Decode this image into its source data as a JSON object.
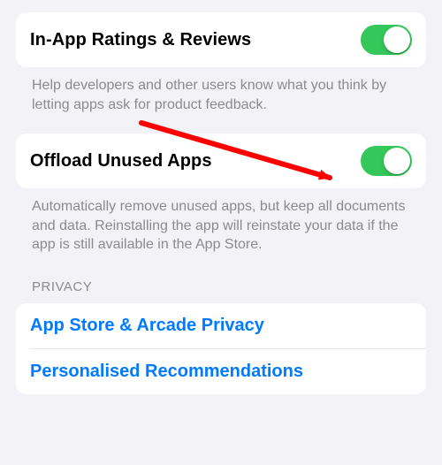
{
  "ratings": {
    "title": "In-App Ratings & Reviews",
    "toggle_on": true,
    "footer": "Help developers and other users know what you think by letting apps ask for product feedback."
  },
  "offload": {
    "title": "Offload Unused Apps",
    "toggle_on": true,
    "footer": "Automatically remove unused apps, but keep all documents and data. Reinstalling the app will reinstate your data if the app is still available in the App Store."
  },
  "privacy": {
    "header": "PRIVACY",
    "items": [
      {
        "label": "App Store & Arcade Privacy"
      },
      {
        "label": "Personalised Recommendations"
      }
    ]
  },
  "annotation": {
    "target": "offload-toggle",
    "color": "#ff0000"
  }
}
